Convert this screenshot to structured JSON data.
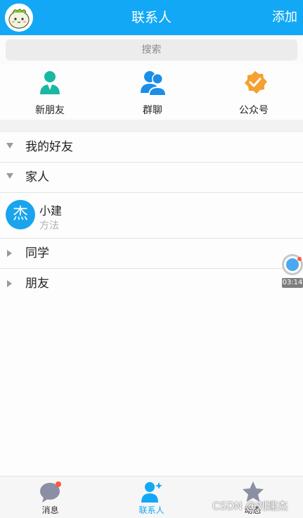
{
  "header": {
    "title": "联系人",
    "add_label": "添加",
    "bg_color": "#12a8f5"
  },
  "search": {
    "placeholder": "搜索"
  },
  "shortcuts": [
    {
      "label": "新朋友",
      "icon": "person-icon",
      "color": "#19b8a2"
    },
    {
      "label": "群聊",
      "icon": "group-icon",
      "color": "#1a8ee8"
    },
    {
      "label": "公众号",
      "icon": "verified-badge-icon",
      "color": "#f5a030"
    }
  ],
  "groups": [
    {
      "name": "我的好友",
      "expanded": true
    },
    {
      "name": "家人",
      "expanded": true
    },
    {
      "name": "同学",
      "expanded": false
    },
    {
      "name": "朋友",
      "expanded": false
    }
  ],
  "contact": {
    "avatar_char": "杰",
    "name": "小建",
    "signature": "方法"
  },
  "floating_widget": {
    "time": "03:14"
  },
  "tabs": [
    {
      "label": "消息",
      "icon": "message-bubble-icon",
      "active": false
    },
    {
      "label": "联系人",
      "icon": "contacts-icon",
      "active": true
    },
    {
      "label": "动态",
      "icon": "star-icon",
      "active": false
    }
  ],
  "watermark": "CSDN @刘建杰"
}
